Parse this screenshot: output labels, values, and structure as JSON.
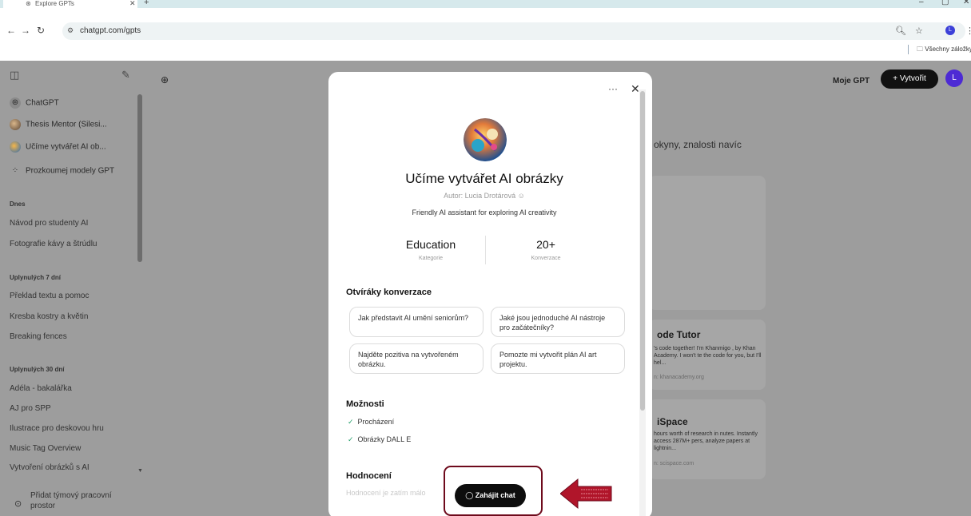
{
  "browser": {
    "tab_title": "Explore GPTs",
    "url": "chatgpt.com/gpts",
    "profile_initial": "L",
    "bookmarks_folder": "Všechny záložky"
  },
  "sidebar": {
    "pinned": [
      {
        "label": "ChatGPT",
        "icon": "openai-icon"
      },
      {
        "label": "Thesis Mentor (Silesi...",
        "icon": "gpt-avatar"
      },
      {
        "label": "Učíme vytvářet AI ob...",
        "icon": "gpt-avatar"
      },
      {
        "label": "Prozkoumej modely GPT",
        "icon": "grid-icon"
      }
    ],
    "groups": [
      {
        "heading": "Dnes",
        "chats": [
          "Návod pro studenty AI",
          "Fotografie kávy a štrúdlu"
        ]
      },
      {
        "heading": "Uplynulých 7 dní",
        "chats": [
          "Překlad textu a pomoc",
          "Kresba kostry a květin",
          "Breaking fences"
        ]
      },
      {
        "heading": "Uplynulých 30 dní",
        "chats": [
          "Adéla - bakalářka",
          "AJ pro SPP",
          "Ilustrace pro deskovou hru",
          "Music Tag Overview",
          "Vytvoření obrázků s AI"
        ]
      }
    ],
    "team_workspace": "Přidat týmový pracovní prostor"
  },
  "header": {
    "my_gpts": "Moje GPT",
    "create_label": "+ Vytvořit",
    "avatar_initial": "L"
  },
  "background": {
    "headline_fragment": "okyny, znalosti navíc",
    "cards": [
      {
        "title": "ode Tutor",
        "desc": "'s code together! I'm Khanmigo , by Khan Academy. I won't te the code for you, but I'll hel...",
        "by": "n: khanacademy.org"
      },
      {
        "title": "iSpace",
        "desc": "hours worth of research in nutes. Instantly access 287M+ pers, analyze papers at lightnin...",
        "by": "n: scispace.com"
      }
    ]
  },
  "modal": {
    "title": "Učíme vytvářet AI obrázky",
    "author": "Autor: Lucia Drotárová",
    "description": "Friendly AI assistant for exploring AI creativity",
    "stats": [
      {
        "value": "Education",
        "label": "Kategorie"
      },
      {
        "value": "20+",
        "label": "Konverzace"
      }
    ],
    "starters_heading": "Otvíráky konverzace",
    "starters": [
      "Jak představit AI umění seniorům?",
      "Jaké jsou jednoduché AI nástroje pro začátečníky?",
      "Najděte pozitiva na vytvořeném obrázku.",
      "Pomozte mi vytvořit plán AI art projektu."
    ],
    "capabilities_heading": "Možnosti",
    "capabilities": [
      "Procházení",
      "Obrázky DALL E"
    ],
    "rating_heading": "Hodnocení",
    "rating_note": "Hodnocení je zatím málo",
    "start_chat": "Zahájit chat"
  },
  "colors": {
    "highlight": "#6e0a1c",
    "arrow": "#b0152a",
    "overlay": "#9d9d9d",
    "check": "#24a06b"
  }
}
